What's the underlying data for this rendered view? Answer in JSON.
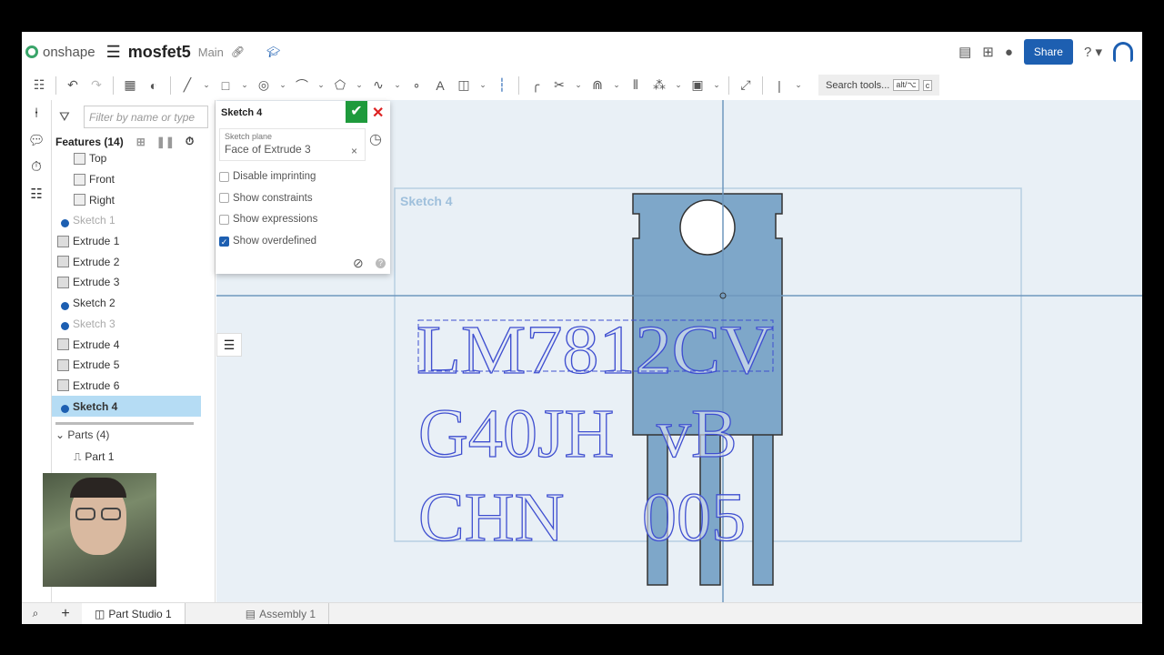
{
  "header": {
    "brand": "onshape",
    "doc_title": "mosfet5",
    "branch": "Main",
    "share": "Share"
  },
  "toolbar": {
    "search": "Search tools...",
    "kbd1": "alt/⌥",
    "kbd2": "c"
  },
  "features": {
    "filter_placeholder": "Filter by name or type",
    "title": "Features (14)",
    "items": [
      {
        "label": "Top",
        "type": "plane"
      },
      {
        "label": "Front",
        "type": "plane"
      },
      {
        "label": "Right",
        "type": "plane"
      },
      {
        "label": "Sketch 1",
        "type": "sketch",
        "dim": true
      },
      {
        "label": "Extrude 1",
        "type": "extrude"
      },
      {
        "label": "Extrude 2",
        "type": "extrude"
      },
      {
        "label": "Extrude 3",
        "type": "extrude"
      },
      {
        "label": "Sketch 2",
        "type": "sketch"
      },
      {
        "label": "Sketch 3",
        "type": "sketch",
        "dim": true
      },
      {
        "label": "Extrude 4",
        "type": "extrude"
      },
      {
        "label": "Extrude 5",
        "type": "extrude"
      },
      {
        "label": "Extrude 6",
        "type": "extrude"
      },
      {
        "label": "Sketch 4",
        "type": "sketch",
        "selected": true
      }
    ],
    "parts_title": "Parts (4)",
    "part1": "Part 1"
  },
  "dialog": {
    "title": "Sketch 4",
    "plane_label": "Sketch plane",
    "plane_value": "Face of Extrude 3",
    "options": [
      {
        "label": "Disable imprinting",
        "checked": false
      },
      {
        "label": "Show constraints",
        "checked": false
      },
      {
        "label": "Show expressions",
        "checked": false
      },
      {
        "label": "Show overdefined",
        "checked": true
      }
    ]
  },
  "viewport": {
    "sketch_label": "Sketch 4",
    "line1": "LM7812CV",
    "line2a": "G40JH",
    "line2b": "vB",
    "line3a": "CHN",
    "line3b": "005"
  },
  "tabs": {
    "part_studio": "Part Studio 1",
    "assembly": "Assembly 1"
  }
}
